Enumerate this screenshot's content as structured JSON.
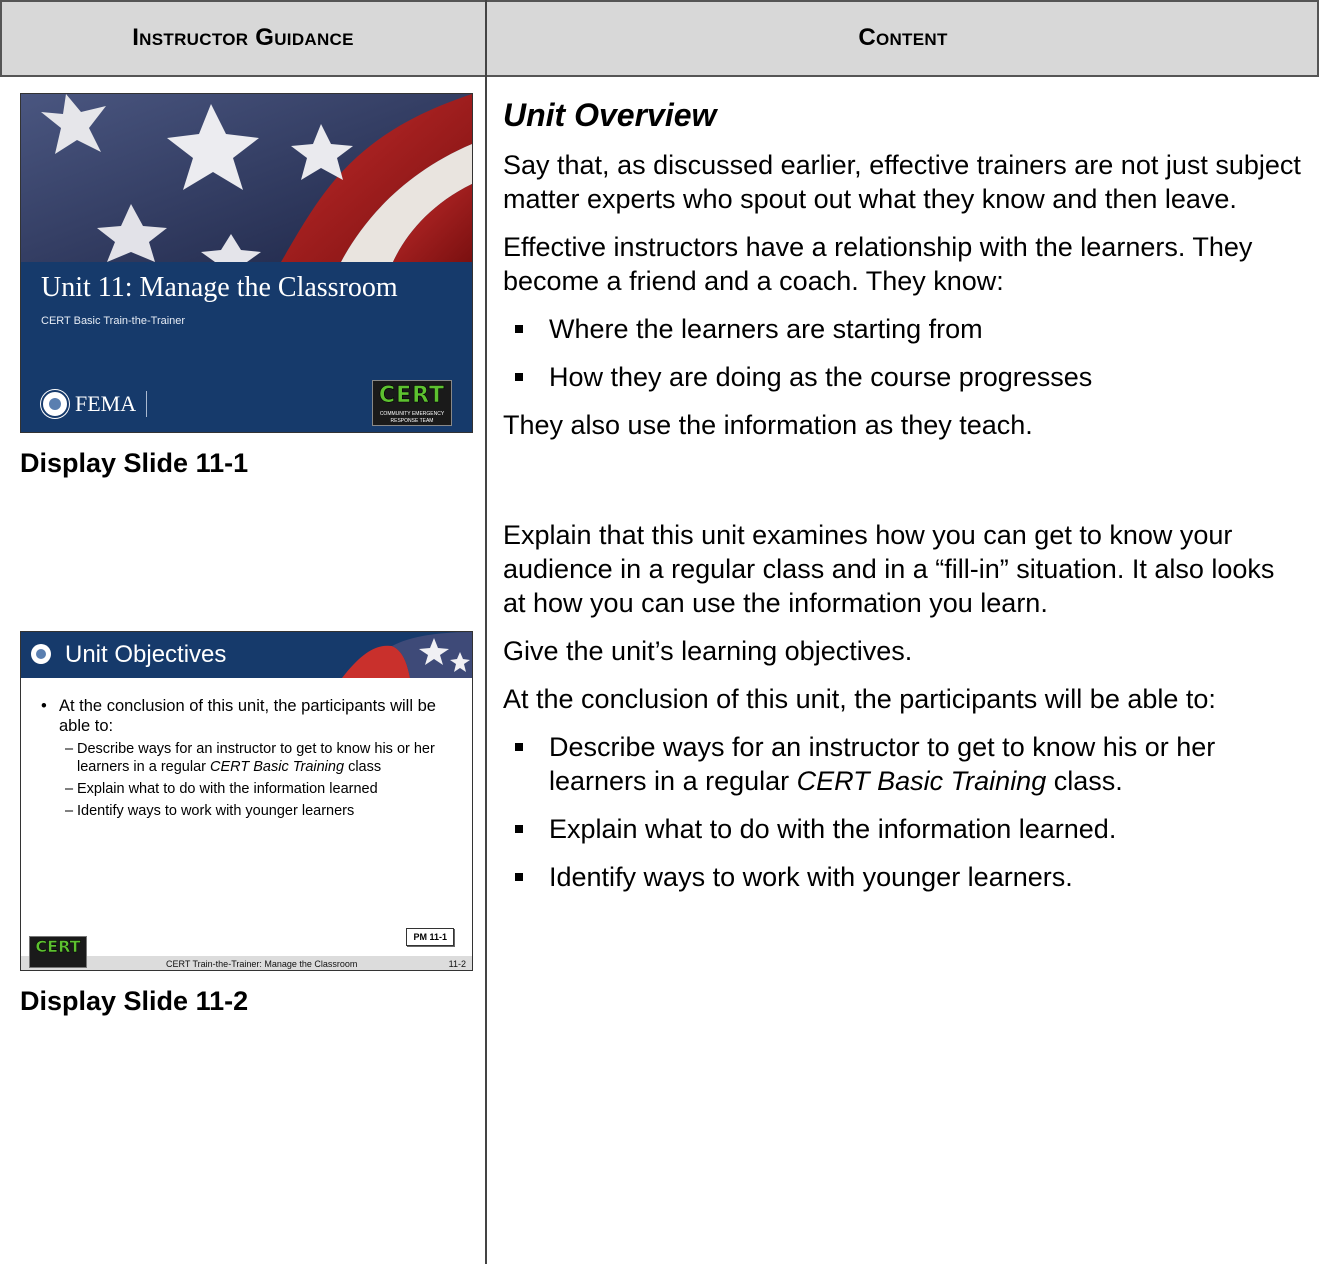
{
  "header": {
    "left": "Instructor Guidance",
    "right": "Content"
  },
  "slide1": {
    "title": "Unit 11: Manage the Classroom",
    "subtitle": "CERT Basic Train-the-Trainer",
    "fema": "FEMA",
    "cert_logo": "CERT",
    "cert_logo_sub": "COMMUNITY EMERGENCY RESPONSE TEAM",
    "caption": "Display Slide 11-1"
  },
  "slide2": {
    "title": "Unit Objectives",
    "intro": "At the conclusion of this unit, the participants will be able to:",
    "objective1_pre": "Describe ways for an instructor to get to know his or her learners in a regular ",
    "objective1_em": "CERT Basic Training",
    "objective1_post": " class",
    "objective2": "Explain what to do with the information learned",
    "objective3": "Identify ways to work with younger learners",
    "pm": "PM 11-1",
    "footer": "CERT Train-the-Trainer:  Manage the Classroom",
    "page": "11-2",
    "cert_logo": "CERT",
    "caption": "Display Slide 11-2"
  },
  "content": {
    "heading": "Unit Overview",
    "p1": "Say that, as discussed earlier, effective trainers are not just subject matter experts who spout out what they know and then leave.",
    "p2": "Effective instructors have a relationship with the learners.  They become a friend and a coach.  They know:",
    "bullets1": [
      "Where the learners are starting from",
      "How they are doing as the course progresses"
    ],
    "p3": "They also use the information as they teach.",
    "p4": "Explain that this unit examines how you can get to know your audience in a regular class and in a “fill-in” situation.  It also looks at how you can use the information you learn.",
    "p5": "Give the unit’s learning objectives.",
    "p6": "At the conclusion of this unit, the participants will be able to:",
    "obj1_pre": "Describe ways for an instructor to get to know his or her learners in a regular ",
    "obj1_em": "CERT Basic Training",
    "obj1_post": " class.",
    "obj2": "Explain what to do with the information learned.",
    "obj3": "Identify ways to work with younger learners."
  }
}
